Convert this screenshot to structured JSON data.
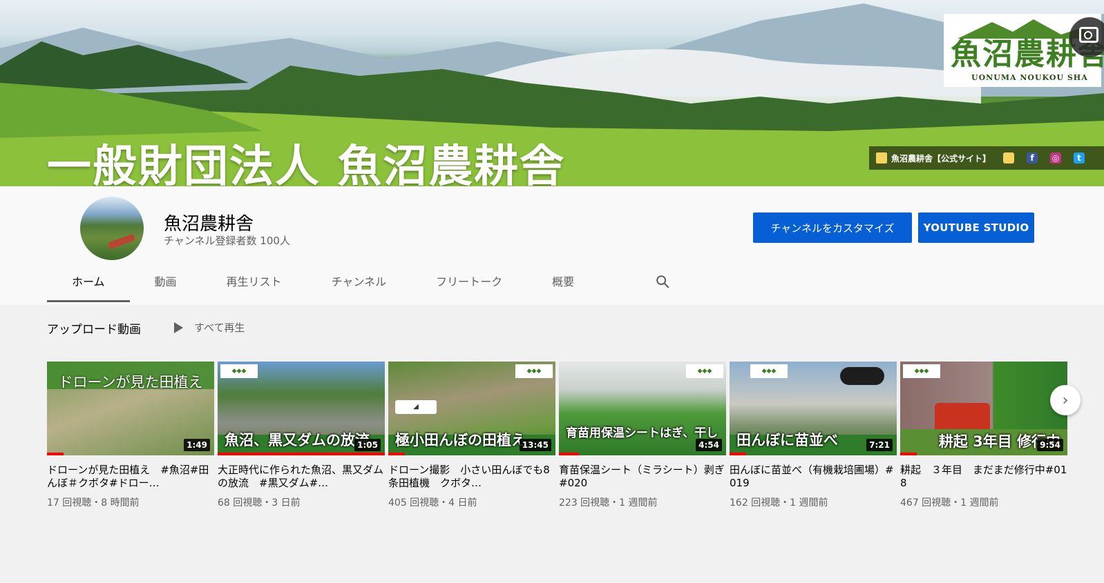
{
  "banner": {
    "title": "一般財団法人 魚沼農耕舎",
    "logo_jp": "魚沼農耕舎",
    "logo_en": "UONUMA NOUKOU SHA",
    "links": {
      "site": "魚沼農耕舎【公式サイト】",
      "icons": [
        "spark-icon",
        "facebook-icon",
        "instagram-icon",
        "twitter-icon"
      ]
    },
    "camera_icon": "camera-icon"
  },
  "channel": {
    "name": "魚沼農耕舎",
    "subscribers": "チャンネル登録者数 100人",
    "customize_label": "チャンネルをカスタマイズ",
    "studio_label": "YOUTUBE STUDIO"
  },
  "tabs": [
    {
      "label": "ホーム"
    },
    {
      "label": "動画"
    },
    {
      "label": "再生リスト"
    },
    {
      "label": "チャンネル"
    },
    {
      "label": "フリートーク"
    },
    {
      "label": "概要"
    }
  ],
  "section": {
    "title": "アップロード動画",
    "play_all": "すべて再生"
  },
  "videos": [
    {
      "thumb_text": "ドローンが見た田植え",
      "duration": "1:49",
      "title": "ドローンが見た田植え　#魚沼#田んぼ＃クボタ#ドロー…",
      "meta": "17 回視聴・8 時間前",
      "progress": 0.1
    },
    {
      "thumb_text": "魚沼、黒又ダムの放流",
      "duration": "1:05",
      "title": "大正時代に作られた魚沼、黒又ダムの放流　#黒又ダム#…",
      "meta": "68 回視聴・3 日前",
      "progress": 1.0
    },
    {
      "thumb_text": "極小田んぼの田植え",
      "duration": "13:45",
      "title": "ドローン撮影　小さい田んぼでも8条田植機　クボタ…",
      "meta": "405 回視聴・4 日前",
      "progress": 0.1
    },
    {
      "thumb_text": "育苗用保温シートはぎ、干し",
      "duration": "4:54",
      "title": "育苗保温シート（ミラシート）剥ぎ #020",
      "meta": "223 回視聴・1 週間前",
      "progress": 0.12
    },
    {
      "thumb_text": "田んぼに苗並べ",
      "duration": "7:21",
      "title": "田んぼに苗並べ（有機栽培圃場）#019",
      "meta": "162 回視聴・1 週間前",
      "progress": 0.1
    },
    {
      "thumb_text": "耕起 3年目 修行中",
      "duration": "9:54",
      "title": "耕起　３年目　まだまだ修行中#018",
      "meta": "467 回視聴・1 週間前",
      "progress": 0.1
    }
  ]
}
